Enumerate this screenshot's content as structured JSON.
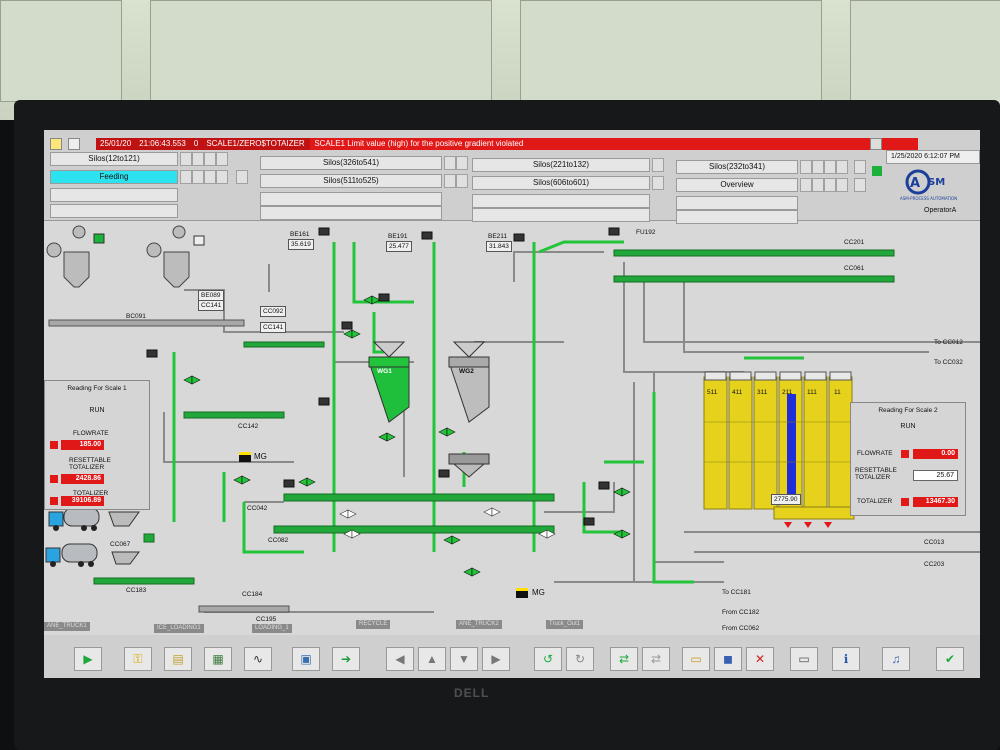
{
  "alarm": {
    "date": "25/01/20",
    "time": "21:06:43.553",
    "num": "0",
    "tag": "SCALE1/ZERO$TOTAIZER",
    "message": "SCALE1 Limit value (high) for the positive gradient violated"
  },
  "status": {
    "datetime": "1/25/2020 6:12:07 PM",
    "operator": "OperatorA"
  },
  "nav": {
    "silos_12to121": "Silos(12to121)",
    "feeding": "Feeding",
    "silos_326to541": "Silos(326to541)",
    "silos_511to525": "Silos(511to525)",
    "silos_221to132": "Silos(221to132)",
    "silos_606to601": "Silos(606to601)",
    "silos_232to341": "Silos(232to341)",
    "overview": "Overview"
  },
  "logo": {
    "text": "ASM-PROCESS AUTOMATION"
  },
  "equipment": {
    "be089": "BE089",
    "cc141": "CC141",
    "cc092": "CC092",
    "cc141b": "CC141",
    "bc091": "BC091",
    "cc142": "CC142",
    "cc042": "CC042",
    "cc082": "CC082",
    "cc067": "CC067",
    "cc183": "CC183",
    "cc184": "CC184",
    "cc195": "CC195",
    "be161": "BE161",
    "be161_val": "35.619",
    "be191": "BE191",
    "be191_val": "25.477",
    "be211": "BE211",
    "be211_val": "31.843",
    "fu192": "FU192",
    "cc201": "CC201",
    "cc061": "CC061",
    "wg1": "WG1",
    "wg2": "WG2",
    "mg1": "MG",
    "mg2": "MG",
    "to_cc012": "To CC012",
    "to_cc032": "To CC032",
    "cc013": "CC013",
    "cc203": "CC203",
    "to_cc181": "To CC181",
    "from_cc182": "From CC182",
    "from_cc062": "From CC062",
    "silo_ids": [
      "511",
      "411",
      "311",
      "211",
      "111",
      "11"
    ],
    "silo_level": "2775.90"
  },
  "scale1": {
    "title": "Reading For Scale 1",
    "state": "RUN",
    "flowrate_label": "FLOWRATE",
    "flowrate": "185.00",
    "resettable_label": "RESETTABLE\nTOTALIZER",
    "resettable": "2428.86",
    "totalizer_label": "TOTALIZER",
    "totalizer": "39106.89"
  },
  "scale2": {
    "title": "Reading For Scale 2",
    "state": "RUN",
    "flowrate_label": "FLOWRATE",
    "flowrate": "0.00",
    "resettable_label": "RESETTABLE\nTOTALIZER",
    "resettable": "25.67",
    "totalizer_label": "TOTALIZER",
    "totalizer": "13467.30"
  },
  "bottom_tabs": [
    "ANE_TRUCK1",
    "ICE_LOADING1",
    "LOADING_1",
    "RECYCLE",
    "ANE_TRUCK2",
    "Truck_Out1"
  ],
  "toolbar_icons": [
    "start-icon",
    "key-icon",
    "notes-icon",
    "report-icon",
    "trend-chart-icon",
    "log-icon",
    "export-icon",
    "arrow-left-icon",
    "arrow-up-icon",
    "arrow-down-icon",
    "arrow-right-icon",
    "refresh-icon",
    "forward-icon",
    "transfer-icon",
    "transfer-grey-icon",
    "folder-icon",
    "save-icon",
    "delete-icon",
    "screen-icon",
    "info-icon",
    "audio-icon",
    "acknowledge-icon"
  ],
  "colors": {
    "alarm_red": "#e01818",
    "feeding_active": "#2de2ef",
    "pipe_green": "#22c43a",
    "silo_yellow": "#e6d21c",
    "silo_active_blue": "#1e2ed8"
  },
  "brand": "DELL"
}
